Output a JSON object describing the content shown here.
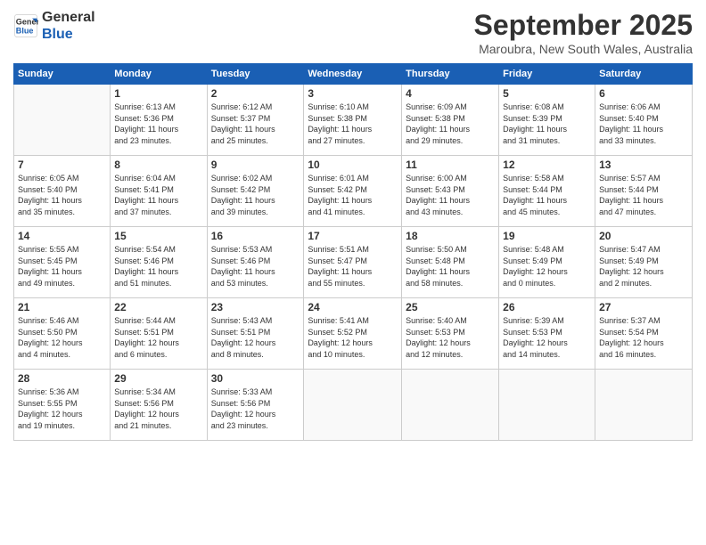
{
  "header": {
    "logo_line1": "General",
    "logo_line2": "Blue",
    "month_title": "September 2025",
    "location": "Maroubra, New South Wales, Australia"
  },
  "days_of_week": [
    "Sunday",
    "Monday",
    "Tuesday",
    "Wednesday",
    "Thursday",
    "Friday",
    "Saturday"
  ],
  "weeks": [
    [
      {
        "day": "",
        "info": ""
      },
      {
        "day": "1",
        "info": "Sunrise: 6:13 AM\nSunset: 5:36 PM\nDaylight: 11 hours\nand 23 minutes."
      },
      {
        "day": "2",
        "info": "Sunrise: 6:12 AM\nSunset: 5:37 PM\nDaylight: 11 hours\nand 25 minutes."
      },
      {
        "day": "3",
        "info": "Sunrise: 6:10 AM\nSunset: 5:38 PM\nDaylight: 11 hours\nand 27 minutes."
      },
      {
        "day": "4",
        "info": "Sunrise: 6:09 AM\nSunset: 5:38 PM\nDaylight: 11 hours\nand 29 minutes."
      },
      {
        "day": "5",
        "info": "Sunrise: 6:08 AM\nSunset: 5:39 PM\nDaylight: 11 hours\nand 31 minutes."
      },
      {
        "day": "6",
        "info": "Sunrise: 6:06 AM\nSunset: 5:40 PM\nDaylight: 11 hours\nand 33 minutes."
      }
    ],
    [
      {
        "day": "7",
        "info": "Sunrise: 6:05 AM\nSunset: 5:40 PM\nDaylight: 11 hours\nand 35 minutes."
      },
      {
        "day": "8",
        "info": "Sunrise: 6:04 AM\nSunset: 5:41 PM\nDaylight: 11 hours\nand 37 minutes."
      },
      {
        "day": "9",
        "info": "Sunrise: 6:02 AM\nSunset: 5:42 PM\nDaylight: 11 hours\nand 39 minutes."
      },
      {
        "day": "10",
        "info": "Sunrise: 6:01 AM\nSunset: 5:42 PM\nDaylight: 11 hours\nand 41 minutes."
      },
      {
        "day": "11",
        "info": "Sunrise: 6:00 AM\nSunset: 5:43 PM\nDaylight: 11 hours\nand 43 minutes."
      },
      {
        "day": "12",
        "info": "Sunrise: 5:58 AM\nSunset: 5:44 PM\nDaylight: 11 hours\nand 45 minutes."
      },
      {
        "day": "13",
        "info": "Sunrise: 5:57 AM\nSunset: 5:44 PM\nDaylight: 11 hours\nand 47 minutes."
      }
    ],
    [
      {
        "day": "14",
        "info": "Sunrise: 5:55 AM\nSunset: 5:45 PM\nDaylight: 11 hours\nand 49 minutes."
      },
      {
        "day": "15",
        "info": "Sunrise: 5:54 AM\nSunset: 5:46 PM\nDaylight: 11 hours\nand 51 minutes."
      },
      {
        "day": "16",
        "info": "Sunrise: 5:53 AM\nSunset: 5:46 PM\nDaylight: 11 hours\nand 53 minutes."
      },
      {
        "day": "17",
        "info": "Sunrise: 5:51 AM\nSunset: 5:47 PM\nDaylight: 11 hours\nand 55 minutes."
      },
      {
        "day": "18",
        "info": "Sunrise: 5:50 AM\nSunset: 5:48 PM\nDaylight: 11 hours\nand 58 minutes."
      },
      {
        "day": "19",
        "info": "Sunrise: 5:48 AM\nSunset: 5:49 PM\nDaylight: 12 hours\nand 0 minutes."
      },
      {
        "day": "20",
        "info": "Sunrise: 5:47 AM\nSunset: 5:49 PM\nDaylight: 12 hours\nand 2 minutes."
      }
    ],
    [
      {
        "day": "21",
        "info": "Sunrise: 5:46 AM\nSunset: 5:50 PM\nDaylight: 12 hours\nand 4 minutes."
      },
      {
        "day": "22",
        "info": "Sunrise: 5:44 AM\nSunset: 5:51 PM\nDaylight: 12 hours\nand 6 minutes."
      },
      {
        "day": "23",
        "info": "Sunrise: 5:43 AM\nSunset: 5:51 PM\nDaylight: 12 hours\nand 8 minutes."
      },
      {
        "day": "24",
        "info": "Sunrise: 5:41 AM\nSunset: 5:52 PM\nDaylight: 12 hours\nand 10 minutes."
      },
      {
        "day": "25",
        "info": "Sunrise: 5:40 AM\nSunset: 5:53 PM\nDaylight: 12 hours\nand 12 minutes."
      },
      {
        "day": "26",
        "info": "Sunrise: 5:39 AM\nSunset: 5:53 PM\nDaylight: 12 hours\nand 14 minutes."
      },
      {
        "day": "27",
        "info": "Sunrise: 5:37 AM\nSunset: 5:54 PM\nDaylight: 12 hours\nand 16 minutes."
      }
    ],
    [
      {
        "day": "28",
        "info": "Sunrise: 5:36 AM\nSunset: 5:55 PM\nDaylight: 12 hours\nand 19 minutes."
      },
      {
        "day": "29",
        "info": "Sunrise: 5:34 AM\nSunset: 5:56 PM\nDaylight: 12 hours\nand 21 minutes."
      },
      {
        "day": "30",
        "info": "Sunrise: 5:33 AM\nSunset: 5:56 PM\nDaylight: 12 hours\nand 23 minutes."
      },
      {
        "day": "",
        "info": ""
      },
      {
        "day": "",
        "info": ""
      },
      {
        "day": "",
        "info": ""
      },
      {
        "day": "",
        "info": ""
      }
    ]
  ]
}
